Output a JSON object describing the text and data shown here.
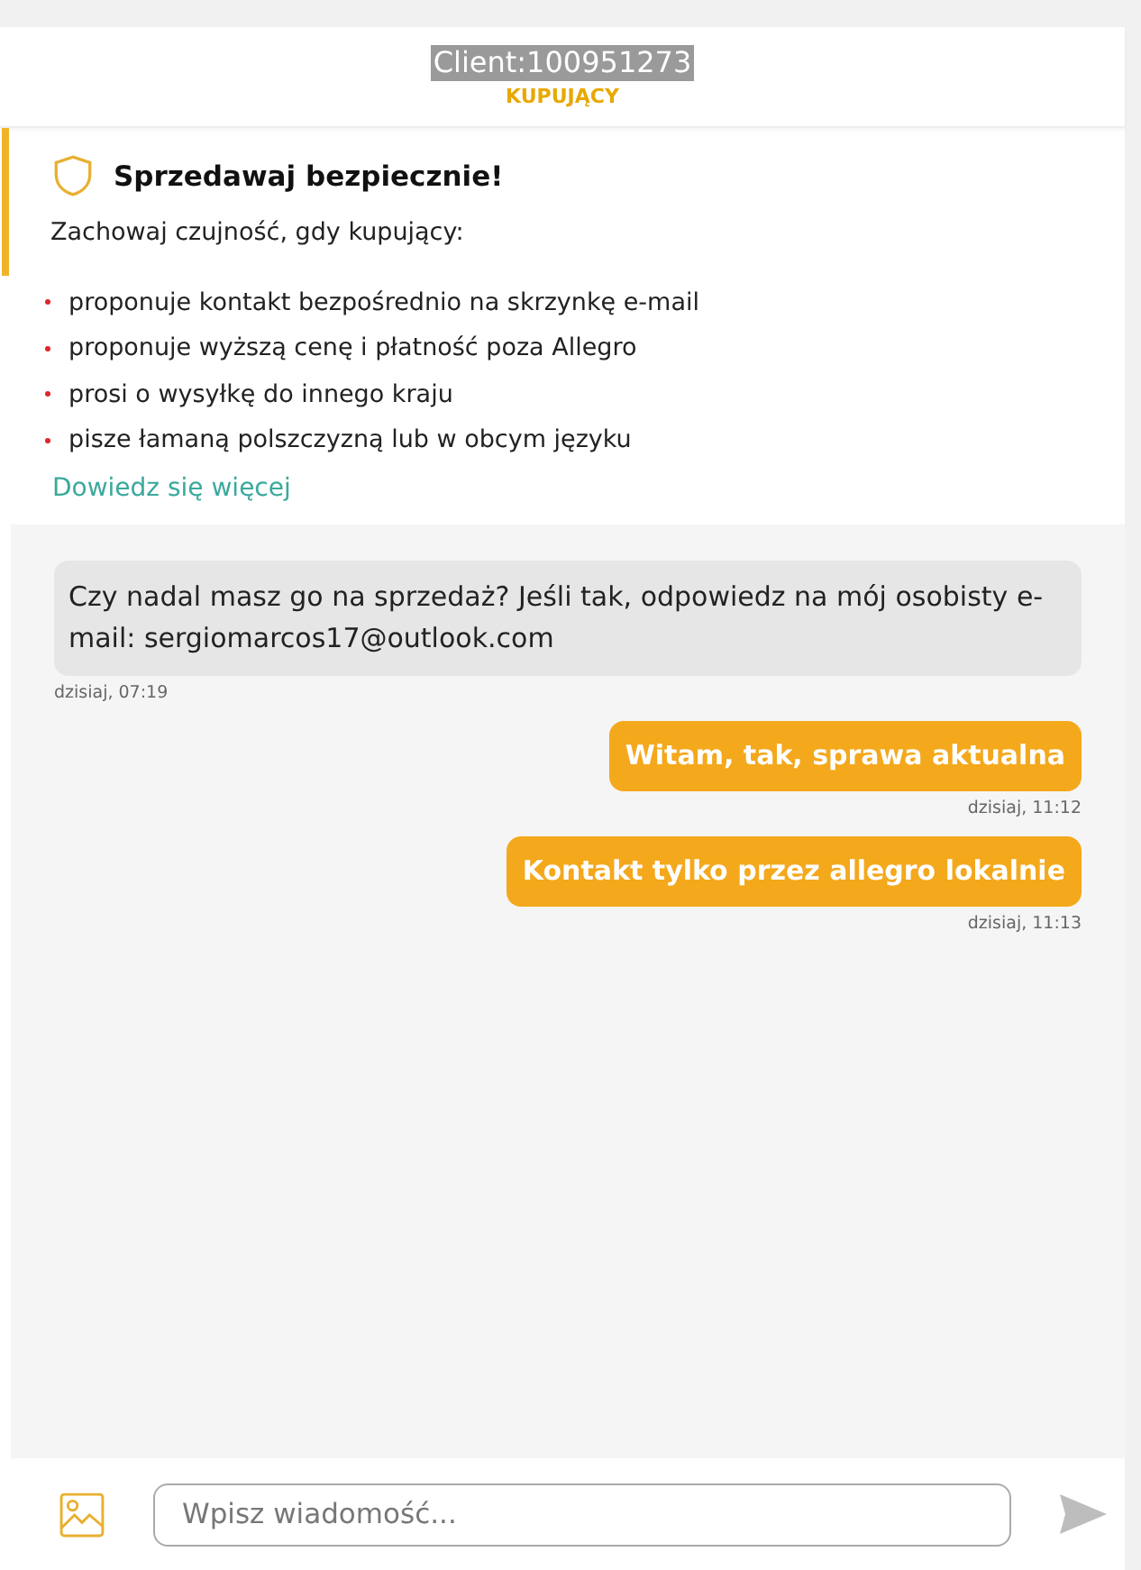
{
  "header": {
    "name": "Client:100951273",
    "role": "KUPUJĄCY"
  },
  "safety": {
    "title": "Sprzedawaj bezpiecznie!",
    "intro": "Zachowaj czujność, gdy kupujący:",
    "items": [
      "proponuje kontakt bezpośrednio na skrzynkę e-mail",
      "proponuje wyższą cenę i płatność poza Allegro",
      "prosi o wysyłkę do innego kraju",
      "pisze łamaną polszczyzną lub w obcym języku"
    ],
    "link": "Dowiedz się więcej"
  },
  "messages": [
    {
      "kind": "incoming",
      "text": "Czy nadal masz go na sprzedaż? Jeśli tak, odpowiedz na mój osobisty e-mail: sergiomarcos17@outlook.com",
      "time": "dzisiaj, 07:19"
    },
    {
      "kind": "outgoing",
      "text": "Witam, tak, sprawa aktualna",
      "time": "dzisiaj, 11:12"
    },
    {
      "kind": "outgoing",
      "text": "Kontakt tylko przez allegro lokalnie",
      "time": "dzisiaj, 11:13"
    }
  ],
  "composer": {
    "placeholder": "Wpisz wiadomość..."
  }
}
